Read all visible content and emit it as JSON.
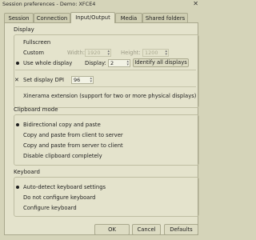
{
  "window": {
    "title": "Session preferences - Demo: XFCE4",
    "close_glyph": "✕"
  },
  "tabs": [
    {
      "label": "Session"
    },
    {
      "label": "Connection"
    },
    {
      "label": "Input/Output"
    },
    {
      "label": "Media"
    },
    {
      "label": "Shared folders"
    }
  ],
  "active_tab": "Input/Output",
  "display": {
    "section_title": "Display",
    "fullscreen_label": "Fullscreen",
    "custom_label": "Custom",
    "width_label": "Width:",
    "width_value": "1920",
    "height_label": "Height:",
    "height_value": "1200",
    "use_whole_label": "Use whole display",
    "display_label": "Display:",
    "display_value": "2",
    "identify_button": "Identify all displays",
    "dpi_label": "Set display DPI",
    "dpi_value": "96",
    "xinerama_label": "Xinerama extension (support for two or more physical displays)",
    "selected": "Use whole display",
    "dpi_checked": true,
    "xinerama_checked": false
  },
  "clipboard": {
    "section_title": "Clipboard mode",
    "options": [
      "Bidirectional copy and paste",
      "Copy and paste from client to server",
      "Copy and paste from server to client",
      "Disable clipboard completely"
    ],
    "selected": "Bidirectional copy and paste"
  },
  "keyboard": {
    "section_title": "Keyboard",
    "options": [
      "Auto-detect keyboard settings",
      "Do not configure keyboard",
      "Configure keyboard"
    ],
    "selected": "Auto-detect keyboard settings"
  },
  "buttons": {
    "ok": "OK",
    "cancel": "Cancel",
    "defaults": "Defaults"
  },
  "colors": {
    "background": "#d5d4b9",
    "panel": "#e4e3cc",
    "border": "#a9a88d"
  }
}
